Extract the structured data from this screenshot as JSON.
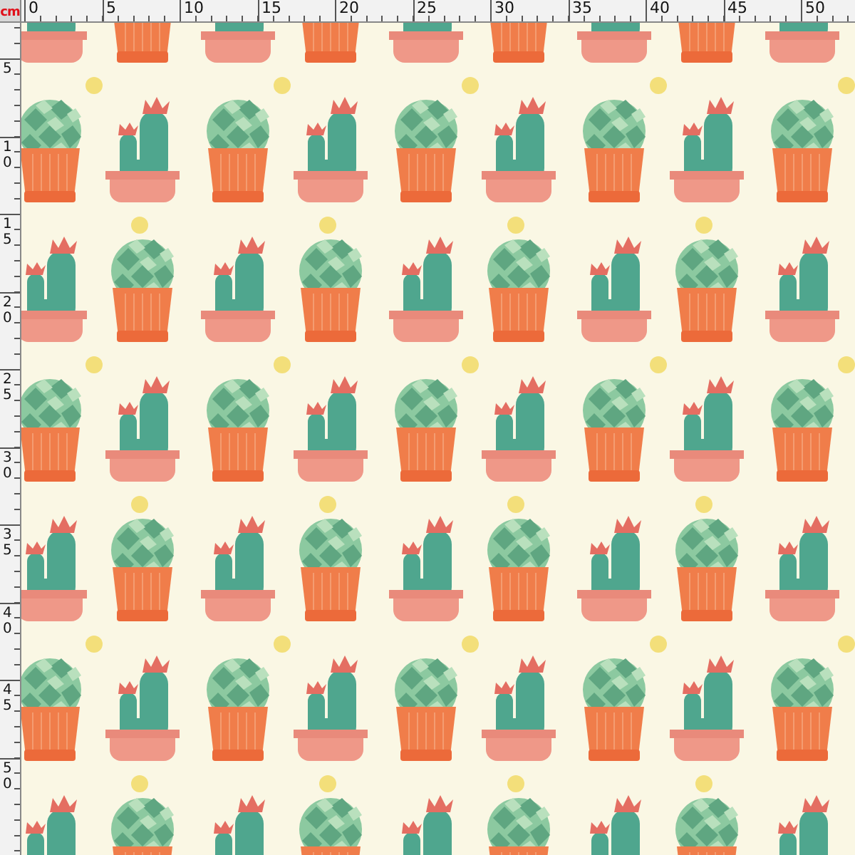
{
  "ruler": {
    "unit": "cm",
    "top_labels": [
      "0",
      "5",
      "10",
      "15",
      "20",
      "25",
      "30",
      "35",
      "40",
      "45",
      "50"
    ],
    "left_labels": [
      "5",
      "10",
      "15",
      "20",
      "25",
      "30",
      "35",
      "40",
      "45",
      "50"
    ]
  }
}
